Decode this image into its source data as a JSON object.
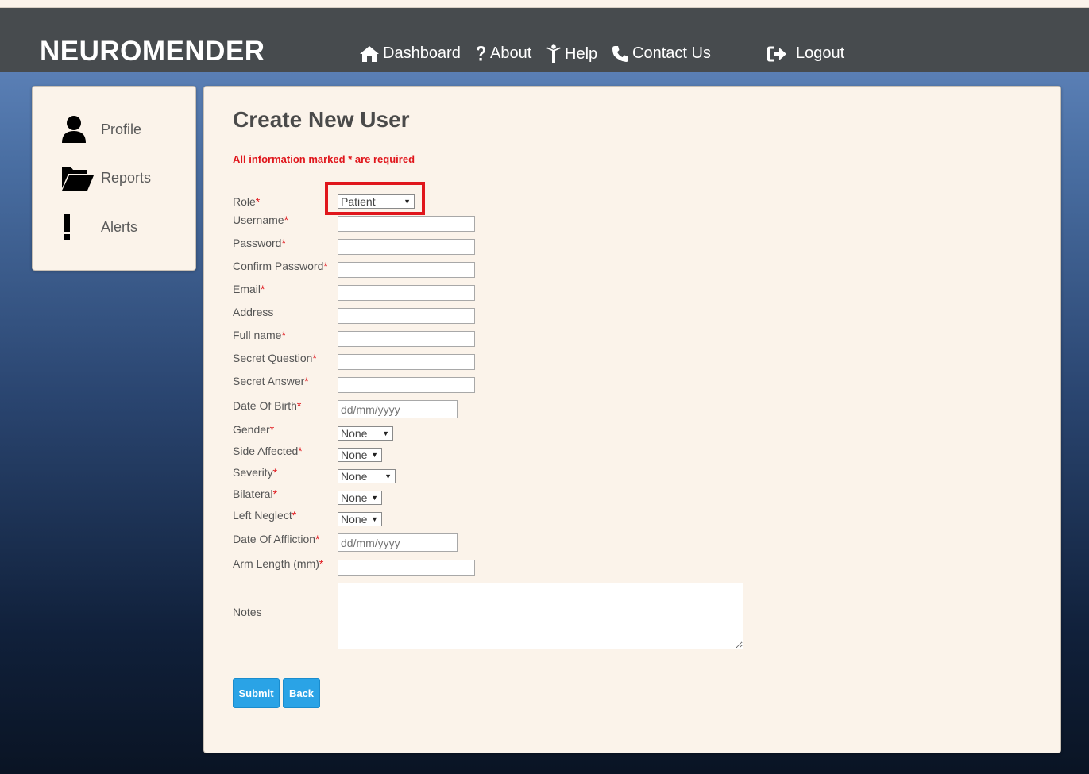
{
  "brand": "NEUROMENDER",
  "nav": {
    "dashboard": "Dashboard",
    "about": "About",
    "help": "Help",
    "contact": "Contact Us",
    "logout": "Logout"
  },
  "sidebar": {
    "items": [
      {
        "label": "Profile",
        "icon": "user-icon"
      },
      {
        "label": "Reports",
        "icon": "folder-open-icon"
      },
      {
        "label": "Alerts",
        "icon": "exclamation-icon"
      }
    ]
  },
  "form": {
    "title": "Create New User",
    "required_note": "All information marked * are required",
    "asterisk": "*",
    "role": {
      "label": "Role",
      "value": "Patient"
    },
    "username": {
      "label": "Username"
    },
    "password": {
      "label": "Password"
    },
    "confirm_password": {
      "label": "Confirm Password"
    },
    "email": {
      "label": "Email"
    },
    "address": {
      "label": "Address"
    },
    "full_name": {
      "label": "Full name"
    },
    "secret_question": {
      "label": "Secret Question"
    },
    "secret_answer": {
      "label": "Secret Answer"
    },
    "dob": {
      "label": "Date Of Birth",
      "placeholder": "dd/mm/yyyy"
    },
    "gender": {
      "label": "Gender",
      "value": "None"
    },
    "side_affected": {
      "label": "Side Affected",
      "value": "None"
    },
    "severity": {
      "label": "Severity",
      "value": "None"
    },
    "bilateral": {
      "label": "Bilateral",
      "value": "None"
    },
    "left_neglect": {
      "label": "Left Neglect",
      "value": "None"
    },
    "date_affliction": {
      "label": "Date Of Affliction",
      "placeholder": "dd/mm/yyyy"
    },
    "arm_length": {
      "label": "Arm Length (mm)"
    },
    "notes": {
      "label": "Notes"
    },
    "submit": "Submit",
    "back": "Back"
  },
  "colors": {
    "navbar": "#474b4e",
    "panel": "#fbf3ea",
    "required": "#e0161c",
    "button": "#2aa3e6"
  }
}
